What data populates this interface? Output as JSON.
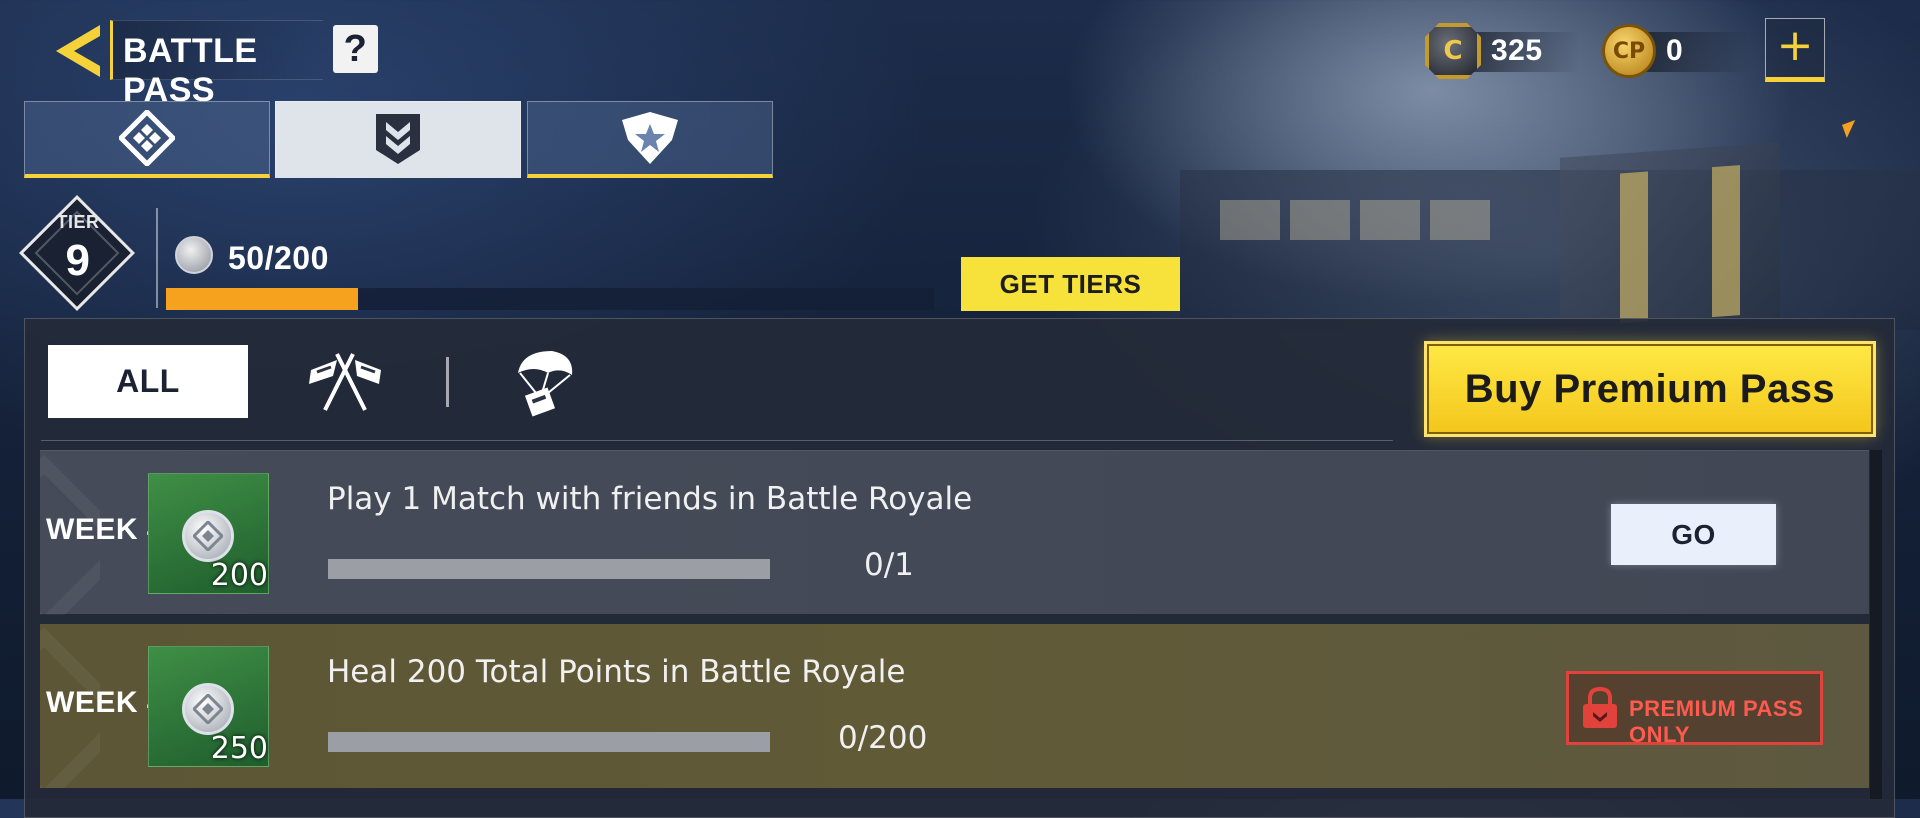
{
  "header": {
    "title": "BATTLE PASS",
    "help": "?"
  },
  "currencies": [
    {
      "symbol": "C",
      "value": "325",
      "icon": "cod-points-c-coin-icon"
    },
    {
      "symbol": "CP",
      "value": "0",
      "icon": "cp-coin-icon"
    }
  ],
  "add_currency": "+",
  "category_tabs": [
    {
      "icon": "battle-pass-diamond-icon",
      "active": false
    },
    {
      "icon": "chevron-shield-icon",
      "active": true
    },
    {
      "icon": "star-shield-icon",
      "active": false
    }
  ],
  "tier": {
    "label": "TIER",
    "number": "9",
    "xp_text": "50/200",
    "xp_fraction": 0.25
  },
  "get_tiers_label": "GET TIERS",
  "filters": {
    "all_label": "ALL",
    "icons": [
      "crossed-flags-icon",
      "airdrop-parachute-icon"
    ]
  },
  "buy_premium_label": "Buy Premium Pass",
  "tasks": [
    {
      "week": "WEEK 4",
      "reward": "200",
      "text": "Play 1 Match with friends in Battle Royale",
      "progress_text": "0/1",
      "progress_fraction": 0,
      "action": "GO",
      "premium": false
    },
    {
      "week": "WEEK 4",
      "reward": "250",
      "text": "Heal 200 Total Points in Battle Royale",
      "progress_text": "0/200",
      "progress_fraction": 0,
      "action": "PREMIUM PASS ONLY",
      "premium": true
    }
  ],
  "colors": {
    "accent_yellow": "#f6d23a",
    "xp_orange": "#f7a21f",
    "premium_red": "#e2423c",
    "reward_green": "#3f8f46"
  }
}
